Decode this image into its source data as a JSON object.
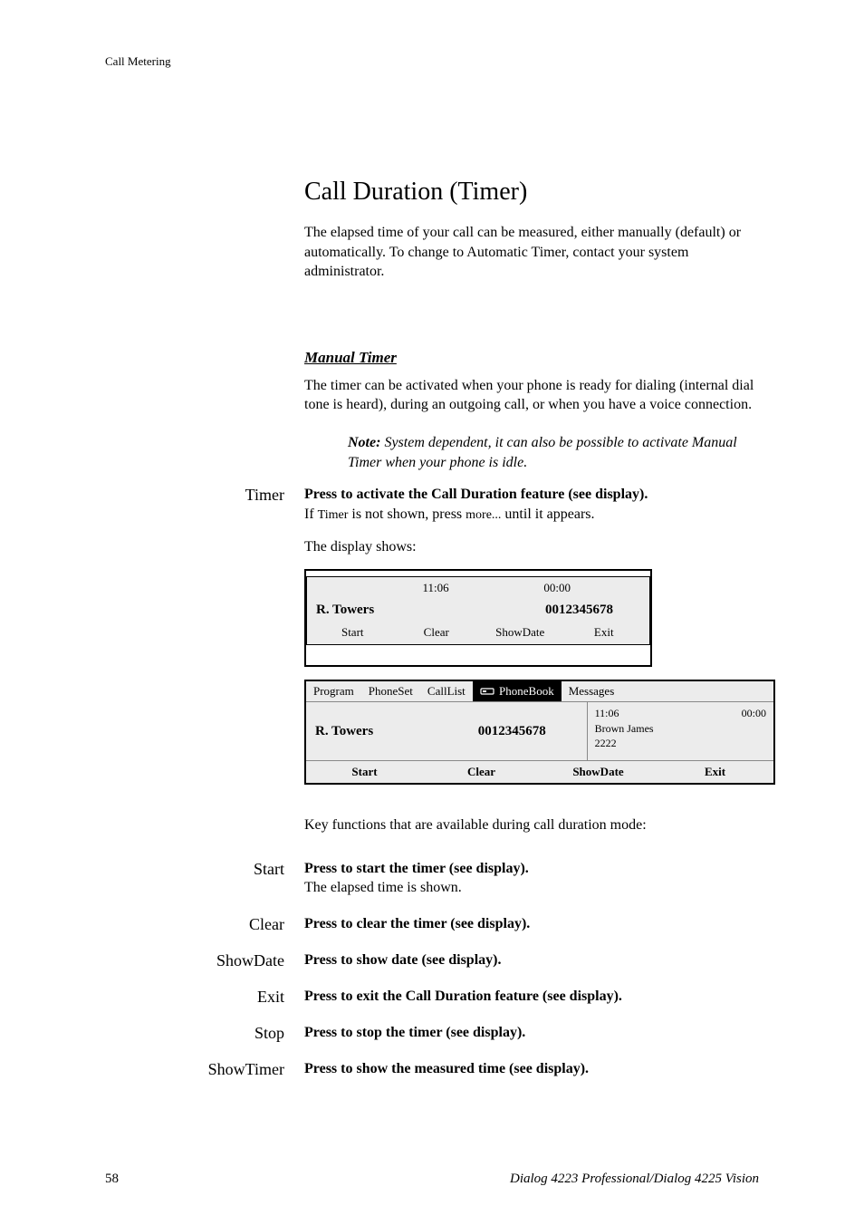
{
  "running_head": "Call Metering",
  "section_title": "Call Duration (Timer)",
  "intro": "The elapsed time of your call can be measured, either manually (default) or automatically. To change to Automatic Timer, contact your system administrator.",
  "manual_timer_heading": "Manual Timer",
  "manual_timer_para": "The timer can be activated when your phone is ready for dialing (internal dial tone is heard), during an outgoing call, or when you have a voice connection.",
  "note_label": "Note:",
  "note_text": " System dependent, it can also be possible to activate Manual Timer when your phone is idle.",
  "timer_label": "Timer",
  "timer_bold": "Press to activate the Call Duration feature (see display).",
  "timer_line2_a": "If ",
  "timer_line2_b": "Timer",
  "timer_line2_c": " is not shown, press ",
  "timer_line2_d": "more...",
  "timer_line2_e": " until it appears.",
  "display_shows": "The display shows:",
  "lcd1": {
    "time": "11:06",
    "timer": "00:00",
    "name": "R. Towers",
    "number": "0012345678",
    "keys": [
      "Start",
      "Clear",
      "ShowDate",
      "Exit"
    ]
  },
  "lcd2": {
    "menus": [
      "Program",
      "PhoneSet",
      "CallList",
      "PhoneBook",
      "Messages"
    ],
    "selected_index": 3,
    "name": "R. Towers",
    "number": "0012345678",
    "right_time": "11:06",
    "right_timer": "00:00",
    "right_caller": "Brown James",
    "right_ext": "2222",
    "softkeys": [
      "Start",
      "Clear",
      "ShowDate",
      "Exit"
    ]
  },
  "key_functions_intro": "Key functions that are available during call duration mode:",
  "functions": [
    {
      "label": "Start",
      "bold": "Press to start the timer (see display).",
      "extra": "The elapsed time is shown."
    },
    {
      "label": "Clear",
      "bold": "Press to clear the timer (see display).",
      "extra": ""
    },
    {
      "label": "ShowDate",
      "bold": "Press to show date (see display).",
      "extra": ""
    },
    {
      "label": "Exit",
      "bold": "Press to exit the Call Duration feature (see display).",
      "extra": ""
    },
    {
      "label": "Stop",
      "bold": "Press to stop the timer (see display).",
      "extra": ""
    },
    {
      "label": "ShowTimer",
      "bold": "Press to show the measured time (see display).",
      "extra": ""
    }
  ],
  "page_number": "58",
  "model": "Dialog 4223 Professional/Dialog 4225 Vision"
}
